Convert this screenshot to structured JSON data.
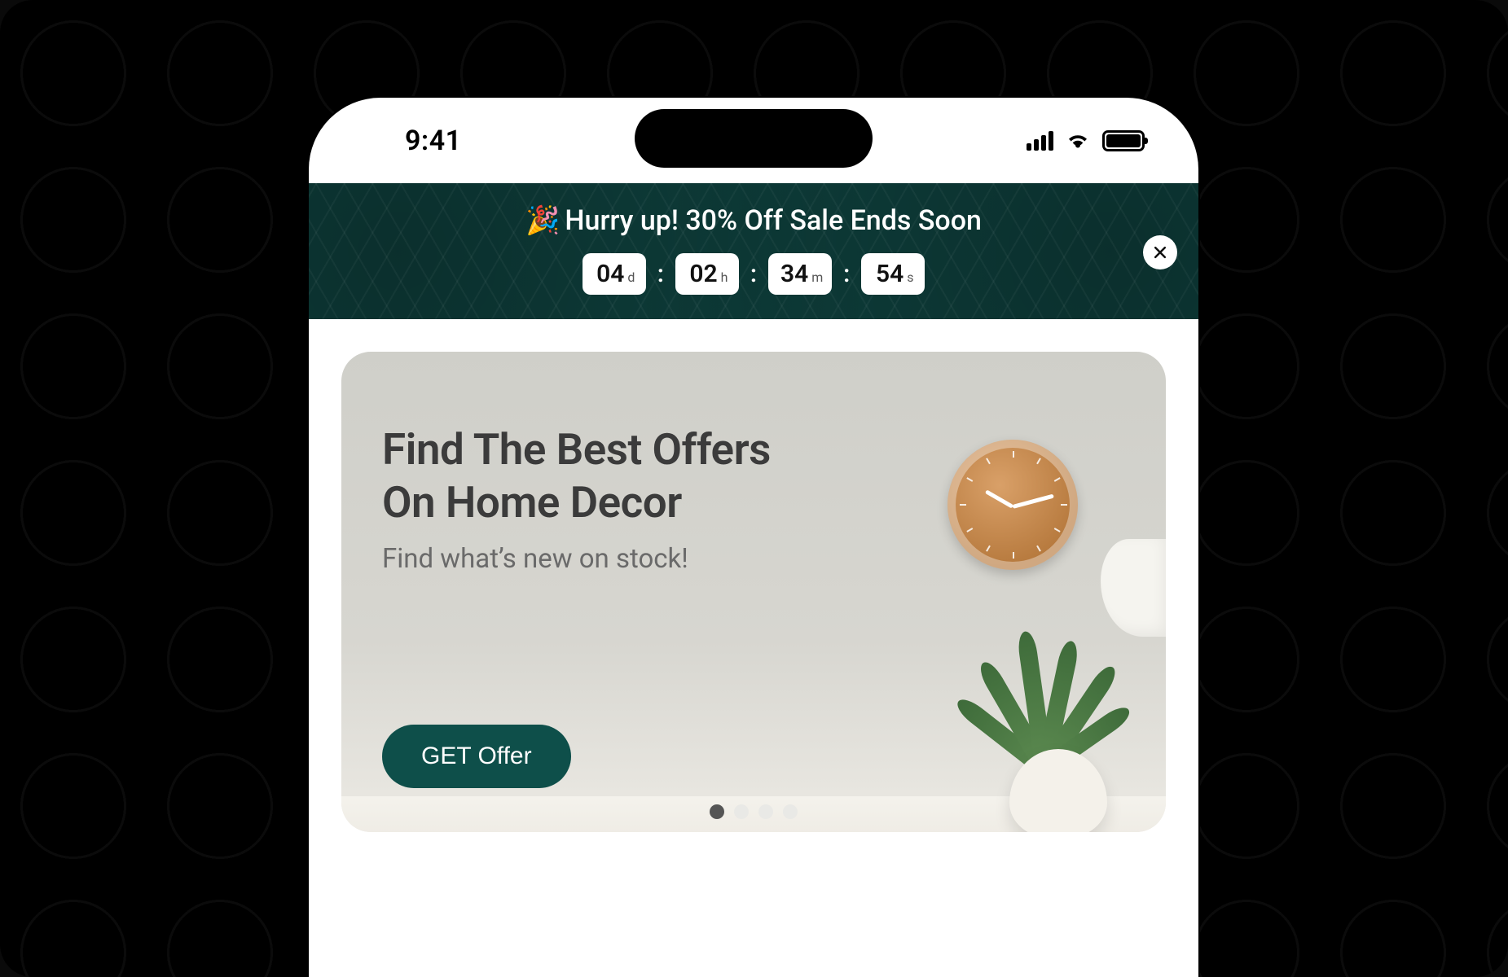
{
  "status": {
    "time": "9:41"
  },
  "banner": {
    "emoji": "🎉",
    "title": "Hurry up! 30% Off Sale Ends Soon",
    "countdown": {
      "days": {
        "value": "04",
        "unit": "d"
      },
      "hours": {
        "value": "02",
        "unit": "h"
      },
      "minutes": {
        "value": "34",
        "unit": "m"
      },
      "seconds": {
        "value": "54",
        "unit": "s"
      }
    }
  },
  "hero": {
    "title_line1": "Find The Best Offers",
    "title_line2": "On Home Decor",
    "subtitle": "Find what’s new on stock!",
    "cta": "GET Offer",
    "page_count": 4,
    "active_page": 1
  },
  "colors": {
    "brand_dark_teal": "#0e4f4a",
    "banner_teal": "#0e3f3c"
  }
}
